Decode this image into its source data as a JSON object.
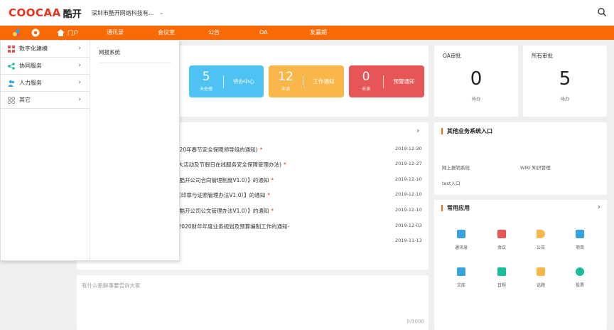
{
  "header": {
    "logo_en": "COOCAA",
    "logo_cn": "酷开",
    "company": "深圳市酷开网络科技有...",
    "company_caret": "⌄"
  },
  "nav": {
    "portal": "门户",
    "items": [
      "通讯录",
      "会议室",
      "公告",
      "OA",
      "友赢朗"
    ]
  },
  "dropdown": {
    "items": [
      {
        "label": "数字化建模",
        "icon": "grid-icon"
      },
      {
        "label": "协同服务",
        "icon": "share-icon"
      },
      {
        "label": "人力服务",
        "icon": "people-icon"
      },
      {
        "label": "其它",
        "icon": "apps-icon"
      }
    ],
    "right_item": "网报系统"
  },
  "stats": [
    {
      "num": "5",
      "sub": "未处理",
      "label": "待办中心",
      "color": "#4ec3f3"
    },
    {
      "num": "12",
      "sub": "未读",
      "label": "工作通知",
      "color": "#fbb64a"
    },
    {
      "num": "0",
      "sub": "未读",
      "label": "预警通知",
      "color": "#e85556"
    }
  ],
  "approval": [
    {
      "title": "OA审批",
      "num": "0",
      "label": "待办"
    },
    {
      "title": "所有审批",
      "num": "5",
      "label": "待办"
    }
  ],
  "notices": [
    {
      "title": "成立2020年春节安全保障领导组的通知)",
      "star": "*",
      "date": "2019-12-30"
    },
    {
      "title": "公司重大活动及节假日在线服务安全保障管理办法)",
      "star": "*",
      "date": "2019-12-27"
    },
    {
      "title": "95号（酷开公司合同管理制度V1.0）】的通知",
      "star": "*",
      "date": "2019-12-10"
    },
    {
      "title": "94 号（印章与证照管理办法V1.0）】的通知",
      "star": "*",
      "date": "2019-12-10"
    },
    {
      "title": "93号（酷开公司公文管理办法V1.0）】的通知",
      "star": "*",
      "date": "2019-12-10"
    },
    {
      "title": "于开展2020财年年度业务规划及预算编制工作的通知-",
      "star": "",
      "date": "2019-12-03"
    },
    {
      "title": "",
      "star": "",
      "date": "2019-11-13"
    }
  ],
  "other_systems": {
    "title": "其他业务系统入口",
    "links": [
      "网上报销系统",
      "WIKI 知识管理",
      "test入口"
    ]
  },
  "common_apps": {
    "title": "常用应用",
    "apps": [
      {
        "label": "通讯录",
        "icon": "contacts-icon",
        "color": "#3aa1e0"
      },
      {
        "label": "会议",
        "icon": "meeting-icon",
        "color": "#e85556"
      },
      {
        "label": "公告",
        "icon": "announce-icon",
        "color": "#fbb64a"
      },
      {
        "label": "项目",
        "icon": "project-icon",
        "color": "#3aa1e0"
      },
      {
        "label": "文库",
        "icon": "library-icon",
        "color": "#3aa1e0"
      },
      {
        "label": "日程",
        "icon": "schedule-icon",
        "color": "#1bbc9b"
      },
      {
        "label": "话题",
        "icon": "topic-icon",
        "color": "#fbb64a"
      },
      {
        "label": "投票",
        "icon": "vote-icon",
        "color": "#1bbc9b"
      }
    ]
  },
  "post": {
    "placeholder": "有什么新鲜事要告诉大家",
    "counter": "0/1000"
  }
}
